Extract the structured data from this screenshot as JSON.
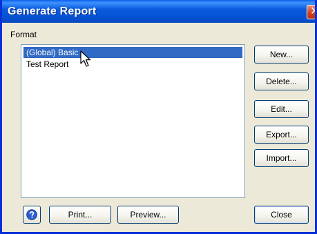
{
  "window": {
    "title": "Generate Report",
    "close_glyph": "✕"
  },
  "format_label": "Format",
  "formats": [
    {
      "label": "(Global) Basic",
      "selected": true
    },
    {
      "label": "Test Report",
      "selected": false
    }
  ],
  "side_buttons": {
    "new": "New...",
    "delete": "Delete...",
    "edit": "Edit...",
    "export": "Export...",
    "import": "Import..."
  },
  "bottom_buttons": {
    "print": "Print...",
    "preview": "Preview...",
    "close": "Close"
  },
  "icons": {
    "help": "help-icon",
    "cursor": "mouse-pointer-icon",
    "close": "close-icon"
  },
  "colors": {
    "titlebar": "#0a5bdc",
    "selection": "#316ac5",
    "dialog_bg": "#ece9d8",
    "close_red": "#d2431c"
  }
}
